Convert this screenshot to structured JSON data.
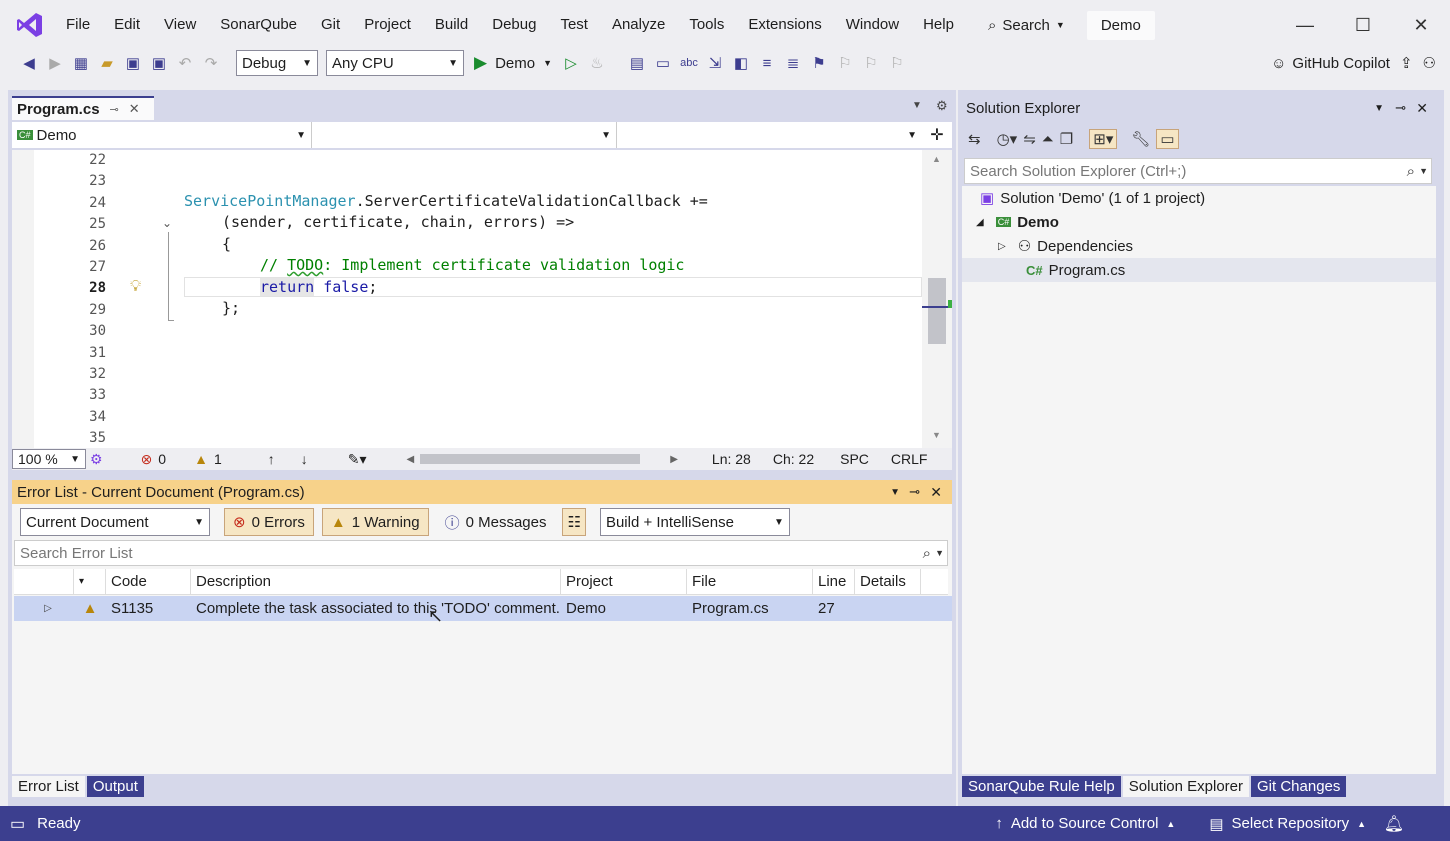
{
  "menu": {
    "items": [
      "File",
      "Edit",
      "View",
      "SonarQube",
      "Git",
      "Project",
      "Build",
      "Debug",
      "Test",
      "Analyze",
      "Tools",
      "Extensions",
      "Window",
      "Help"
    ],
    "search_label": "Search",
    "solution_name": "Demo"
  },
  "toolbar": {
    "config": "Debug",
    "platform": "Any CPU",
    "run_target": "Demo",
    "copilot": "GitHub Copilot"
  },
  "editor": {
    "tab_title": "Program.cs",
    "nav_project": "Demo",
    "line_numbers": [
      "22",
      "23",
      "24",
      "25",
      "26",
      "27",
      "28",
      "29",
      "30",
      "31",
      "32",
      "33",
      "34",
      "35"
    ],
    "current_line": "28",
    "code": {
      "l24_type": "ServicePointManager",
      "l24_rest": ".ServerCertificateValidationCallback +=",
      "l25": "(sender, certificate, chain, errors) =>",
      "l26": "{",
      "l27_comment": "// ",
      "l27_todo": "TODO",
      "l27_rest": ": Implement certificate validation logic",
      "l28_return": "return",
      "l28_false": "false",
      "l28_semi": ";",
      "l29": "};"
    },
    "status": {
      "zoom": "100 %",
      "errors": "0",
      "warnings": "1",
      "ln": "Ln: 28",
      "ch": "Ch: 22",
      "spc": "SPC",
      "crlf": "CRLF"
    }
  },
  "error_list": {
    "title": "Error List - Current Document (Program.cs)",
    "scope": "Current Document",
    "errors_btn": "0 Errors",
    "warnings_btn": "1 Warning",
    "messages_btn": "0 Messages",
    "build_filter": "Build + IntelliSense",
    "search_placeholder": "Search Error List",
    "columns": [
      "Code",
      "Description",
      "Project",
      "File",
      "Line",
      "Details"
    ],
    "rows": [
      {
        "code": "S1135",
        "description": "Complete the task associated to this 'TODO' comment.",
        "project": "Demo",
        "file": "Program.cs",
        "line": "27",
        "details": ""
      }
    ],
    "tabs": [
      "Error List",
      "Output"
    ]
  },
  "solution_explorer": {
    "title": "Solution Explorer",
    "search_placeholder": "Search Solution Explorer (Ctrl+;)",
    "solution": "Solution 'Demo' (1 of 1 project)",
    "project": "Demo",
    "dependencies": "Dependencies",
    "file": "Program.cs",
    "tabs": [
      "SonarQube Rule Help",
      "Solution Explorer",
      "Git Changes"
    ]
  },
  "statusbar": {
    "ready": "Ready",
    "source_control": "Add to Source Control",
    "repository": "Select Repository"
  },
  "colors": {
    "accent": "#3c3f8f",
    "frame": "#d6d8ea",
    "selected_row": "#c9d4f2",
    "warning": "#d29922",
    "error": "#c42b1c"
  }
}
